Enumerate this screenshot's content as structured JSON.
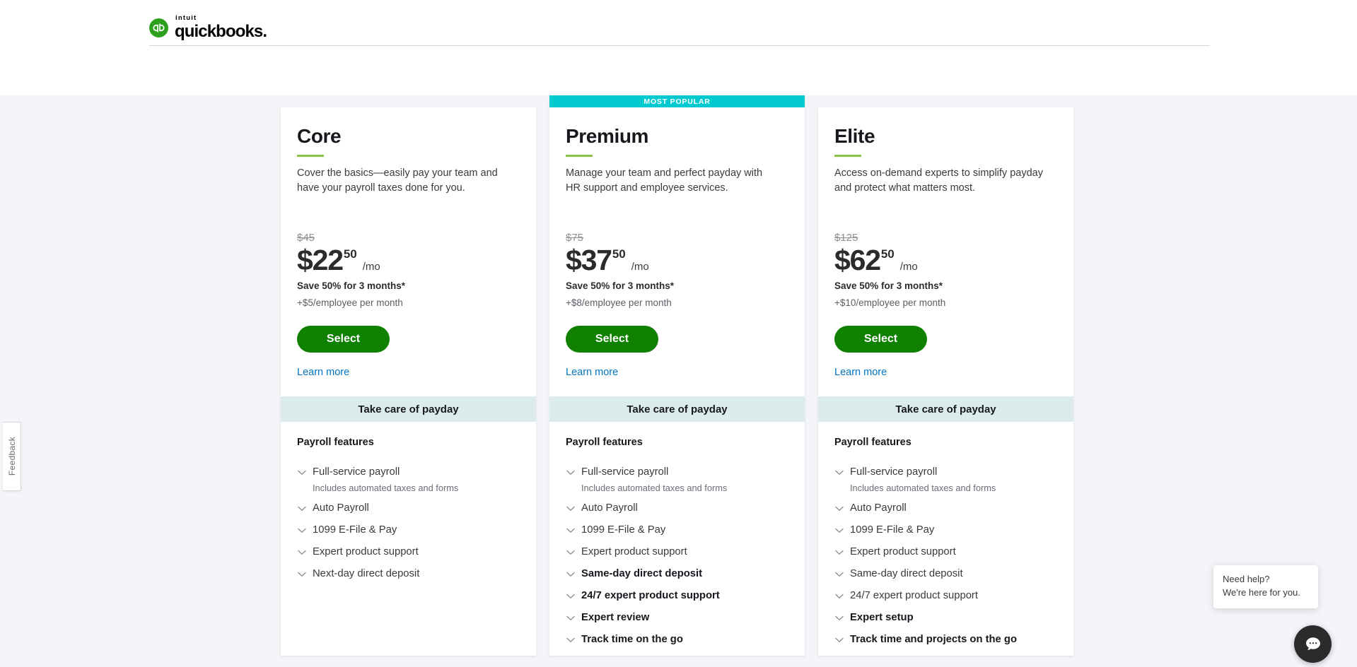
{
  "header": {
    "brand_intuit": "intuit",
    "brand_name": "quickbooks",
    "brand_period": "."
  },
  "colors": {
    "brand_green": "#2CA01C",
    "button_green": "#108000",
    "link_blue": "#0077C5",
    "popular_teal": "#00C9D0",
    "section_header_bg": "#DCEBEC",
    "accent_rule": "#8BC34A",
    "canvas_bg": "#f4f5f8"
  },
  "plans": [
    {
      "name": "Core",
      "popular_label": null,
      "description": "Cover the basics—easily pay your team and have your payroll taxes done for you.",
      "old_price": "$45",
      "price_currency": "$",
      "price_whole": "22",
      "price_cents": "50",
      "price_period": "/mo",
      "save_text": "Save 50% for 3 months*",
      "employee_fee": "+$5/employee per month",
      "select_label": "Select",
      "learn_more_label": "Learn more",
      "section_header": "Take care of payday",
      "features_title": "Payroll features",
      "features": [
        {
          "label": "Full-service payroll",
          "sub": "Includes automated taxes and forms",
          "bold": false
        },
        {
          "label": "Auto Payroll",
          "sub": null,
          "bold": false
        },
        {
          "label": "1099 E-File & Pay",
          "sub": null,
          "bold": false
        },
        {
          "label": "Expert product support",
          "sub": null,
          "bold": false
        },
        {
          "label": "Next-day direct deposit",
          "sub": null,
          "bold": false
        }
      ]
    },
    {
      "name": "Premium",
      "popular_label": "MOST POPULAR",
      "description": "Manage your team and perfect payday with HR support and employee services.",
      "old_price": "$75",
      "price_currency": "$",
      "price_whole": "37",
      "price_cents": "50",
      "price_period": "/mo",
      "save_text": "Save 50% for 3 months*",
      "employee_fee": "+$8/employee per month",
      "select_label": "Select",
      "learn_more_label": "Learn more",
      "section_header": "Take care of payday",
      "features_title": "Payroll features",
      "features": [
        {
          "label": "Full-service payroll",
          "sub": "Includes automated taxes and forms",
          "bold": false
        },
        {
          "label": "Auto Payroll",
          "sub": null,
          "bold": false
        },
        {
          "label": "1099 E-File & Pay",
          "sub": null,
          "bold": false
        },
        {
          "label": "Expert product support",
          "sub": null,
          "bold": false
        },
        {
          "label": "Same-day direct deposit",
          "sub": null,
          "bold": true
        },
        {
          "label": "24/7 expert product support",
          "sub": null,
          "bold": true
        },
        {
          "label": "Expert review",
          "sub": null,
          "bold": true
        },
        {
          "label": "Track time on the go",
          "sub": null,
          "bold": true
        }
      ]
    },
    {
      "name": "Elite",
      "popular_label": null,
      "description": "Access on-demand experts to simplify payday and protect what matters most.",
      "old_price": "$125",
      "price_currency": "$",
      "price_whole": "62",
      "price_cents": "50",
      "price_period": "/mo",
      "save_text": "Save 50% for 3 months*",
      "employee_fee": "+$10/employee per month",
      "select_label": "Select",
      "learn_more_label": "Learn more",
      "section_header": "Take care of payday",
      "features_title": "Payroll features",
      "features": [
        {
          "label": "Full-service payroll",
          "sub": "Includes automated taxes and forms",
          "bold": false
        },
        {
          "label": "Auto Payroll",
          "sub": null,
          "bold": false
        },
        {
          "label": "1099 E-File & Pay",
          "sub": null,
          "bold": false
        },
        {
          "label": "Expert product support",
          "sub": null,
          "bold": false
        },
        {
          "label": "Same-day direct deposit",
          "sub": null,
          "bold": false
        },
        {
          "label": "24/7 expert product support",
          "sub": null,
          "bold": false
        },
        {
          "label": "Expert setup",
          "sub": null,
          "bold": true
        },
        {
          "label": "Track time and projects on the go",
          "sub": null,
          "bold": true
        }
      ]
    }
  ],
  "feedback": {
    "label": "Feedback"
  },
  "help": {
    "line1": "Need help?",
    "line2": "We're here for you.",
    "chat_icon": "chat-bubble-icon"
  }
}
